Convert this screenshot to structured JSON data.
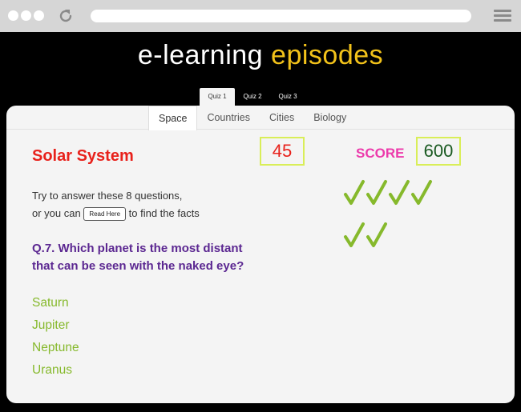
{
  "browser": {
    "buttons": [
      "window-dot",
      "window-dot",
      "window-dot"
    ]
  },
  "logo": {
    "part1": "e-learning",
    "part2": "episodes"
  },
  "quiz_tabs": [
    "Quiz 1",
    "Quiz 2",
    "Quiz 3"
  ],
  "topic_tabs": [
    "Space",
    "Countries",
    "Cities",
    "Biology"
  ],
  "main": {
    "title": "Solar System",
    "timer": "45",
    "score_label": "SCORE",
    "score": "600",
    "intro_line1": "Try to answer these 8 questions,",
    "intro_line2a": "or you can",
    "read_button": "Read Here",
    "intro_line2b": "to find the facts",
    "question": "Q.7. Which planet is the most distant that can be seen with the naked eye?",
    "answers": [
      "Saturn",
      "Jupiter",
      "Neptune",
      "Uranus"
    ],
    "correct_count": 6
  },
  "colors": {
    "title": "#e8211b",
    "score_label": "#ec3aab",
    "question": "#5b2791",
    "answers": "#86b92c",
    "check": "#86b92c",
    "logo_accent": "#f2c21a"
  }
}
